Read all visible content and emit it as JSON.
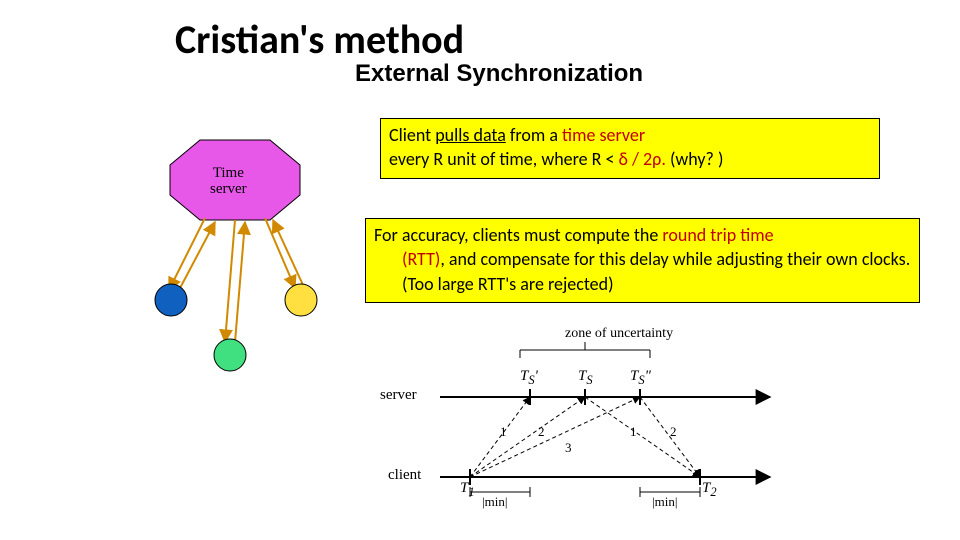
{
  "title": "Cristian's method",
  "subtitle": "External Synchronization",
  "box1": {
    "line1_pre": "Client ",
    "line1_underline": "pulls data",
    "line1_post": " from a ",
    "line1_red": "time server",
    "line2_pre": "every R unit of time, where R < ",
    "line2_red": "δ / 2ρ.",
    "line2_post": " (why? )"
  },
  "box2": {
    "line1_pre": "For accuracy, clients must compute the ",
    "line1_red": "round trip time",
    "line2_red": "(RTT)",
    "line2_post": ", and compensate for this delay  while adjusting their own clocks.  (Too large RTT's are rejected)"
  },
  "diagram": {
    "server_label": "Time\nserver"
  },
  "timing": {
    "zone_label": "zone of uncertainty",
    "server_label": "server",
    "client_label": "client",
    "ticks": {
      "ts_prime": "T",
      "ts_prime_sub": "S",
      "ts_prime_sup": "'",
      "ts": "T",
      "ts_sub": "S",
      "ts_dprime": "T",
      "ts_dprime_sub": "S",
      "ts_dprime_sup": "\"",
      "t1": "T",
      "t1_sub": "1",
      "t2": "T",
      "t2_sub": "2"
    },
    "nums": [
      "1",
      "2",
      "3",
      "1",
      "2"
    ],
    "min": "min"
  },
  "chart_data": {
    "type": "diagram",
    "description": "Cristian's algorithm. A magenta octagon labeled 'Time server' sends/receives messages (arrows) to three client nodes drawn as small coloured circles (blue, yellow, green). Below, a timing diagram shows two horizontal timelines 'server' and 'client'. Client sends request at T1, three possible server receive times T_S', T_S, T_S'' span a 'zone of uncertainty'; reply arrives at client at T2. |min| intervals bracket T1→ and →T2 on the client line. Dashed diagonals numbered 1,2,3 (up) and 1,2 (down) connect the two lines."
  }
}
